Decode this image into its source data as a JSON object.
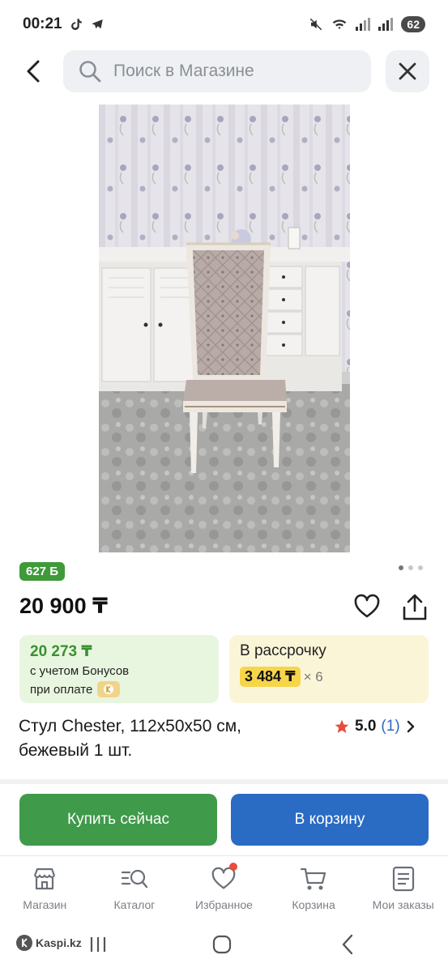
{
  "status_bar": {
    "time": "00:21",
    "battery": "62"
  },
  "search": {
    "placeholder": "Поиск в Магазине"
  },
  "product": {
    "bonus_points": "627 Б",
    "price": "20 900 ₸",
    "bonus_price": {
      "amount": "20 273 ₸",
      "line1": "с учетом Бонусов",
      "line2": "при оплате"
    },
    "installment": {
      "title": "В рассрочку",
      "amount": "3 484 ₸",
      "multiplier": "× 6"
    },
    "title": "Стул Chester, 112x50x50 см, бежевый 1 шт.",
    "rating": {
      "value": "5.0",
      "count": "(1)"
    },
    "images_total": 3,
    "current_image": 1
  },
  "actions": {
    "buy_now": "Купить сейчас",
    "add_to_cart": "В корзину"
  },
  "bottom_nav": {
    "items": [
      {
        "label": "Магазин",
        "icon": "shop-icon"
      },
      {
        "label": "Каталог",
        "icon": "catalog-search-icon"
      },
      {
        "label": "Избранное",
        "icon": "heart-icon"
      },
      {
        "label": "Корзина",
        "icon": "cart-icon"
      },
      {
        "label": "Мои заказы",
        "icon": "orders-icon"
      }
    ]
  },
  "system_nav": {
    "brand": "Kaspi.kz"
  },
  "colors": {
    "green": "#3f9a4a",
    "blue": "#2a6bc4",
    "bonus_bg": "#e9f6df",
    "installment_bg": "#fbf5d8",
    "installment_highlight": "#f6d54a",
    "star": "#e74c3c"
  }
}
